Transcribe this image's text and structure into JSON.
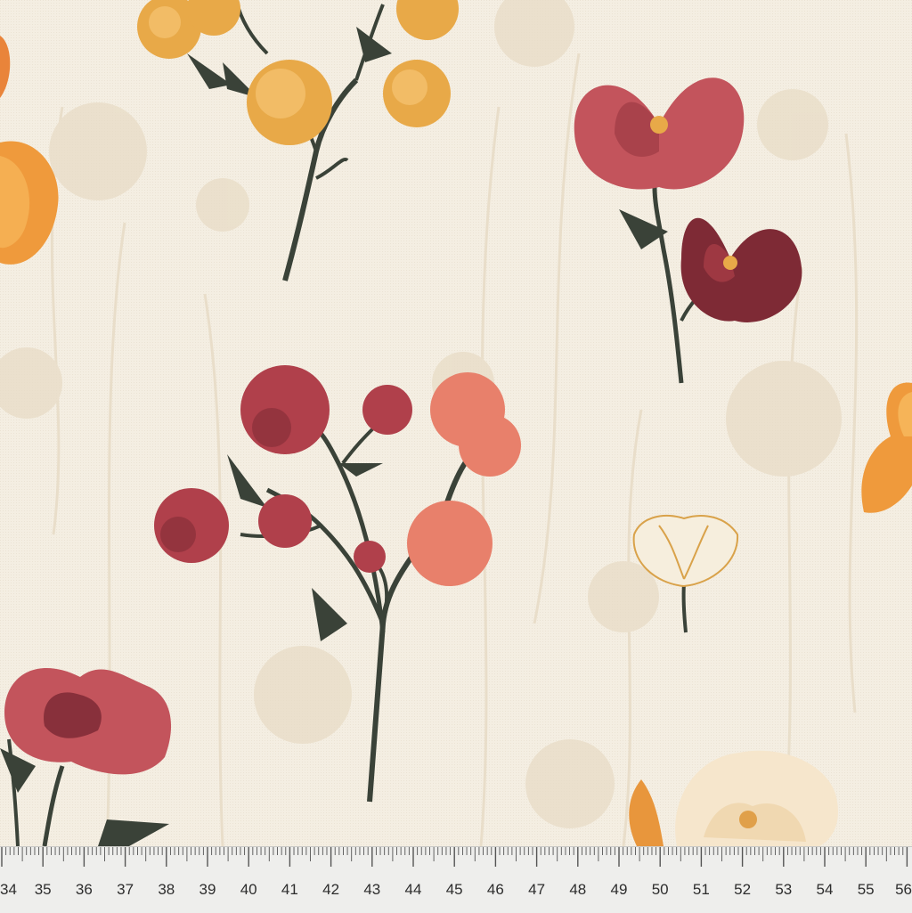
{
  "image": {
    "subject": "floral print fabric",
    "background_color": "#f3ede1"
  },
  "colors": {
    "cream": "#f3ede1",
    "shadow_flower": "#e6d9c3",
    "stem": "#3a4238",
    "mustard": "#e8a948",
    "burgundy": "#7e2a35",
    "rose": "#c3545c",
    "coral": "#e8806b",
    "orange": "#ef9a3c",
    "ruler": "#eeeeec"
  },
  "ruler": {
    "numbers": [
      "34",
      "35",
      "36",
      "37",
      "38",
      "39",
      "40",
      "41",
      "42",
      "43",
      "44",
      "45",
      "46",
      "47",
      "48",
      "49",
      "50",
      "51",
      "52",
      "53",
      "54",
      "55",
      "56"
    ]
  }
}
